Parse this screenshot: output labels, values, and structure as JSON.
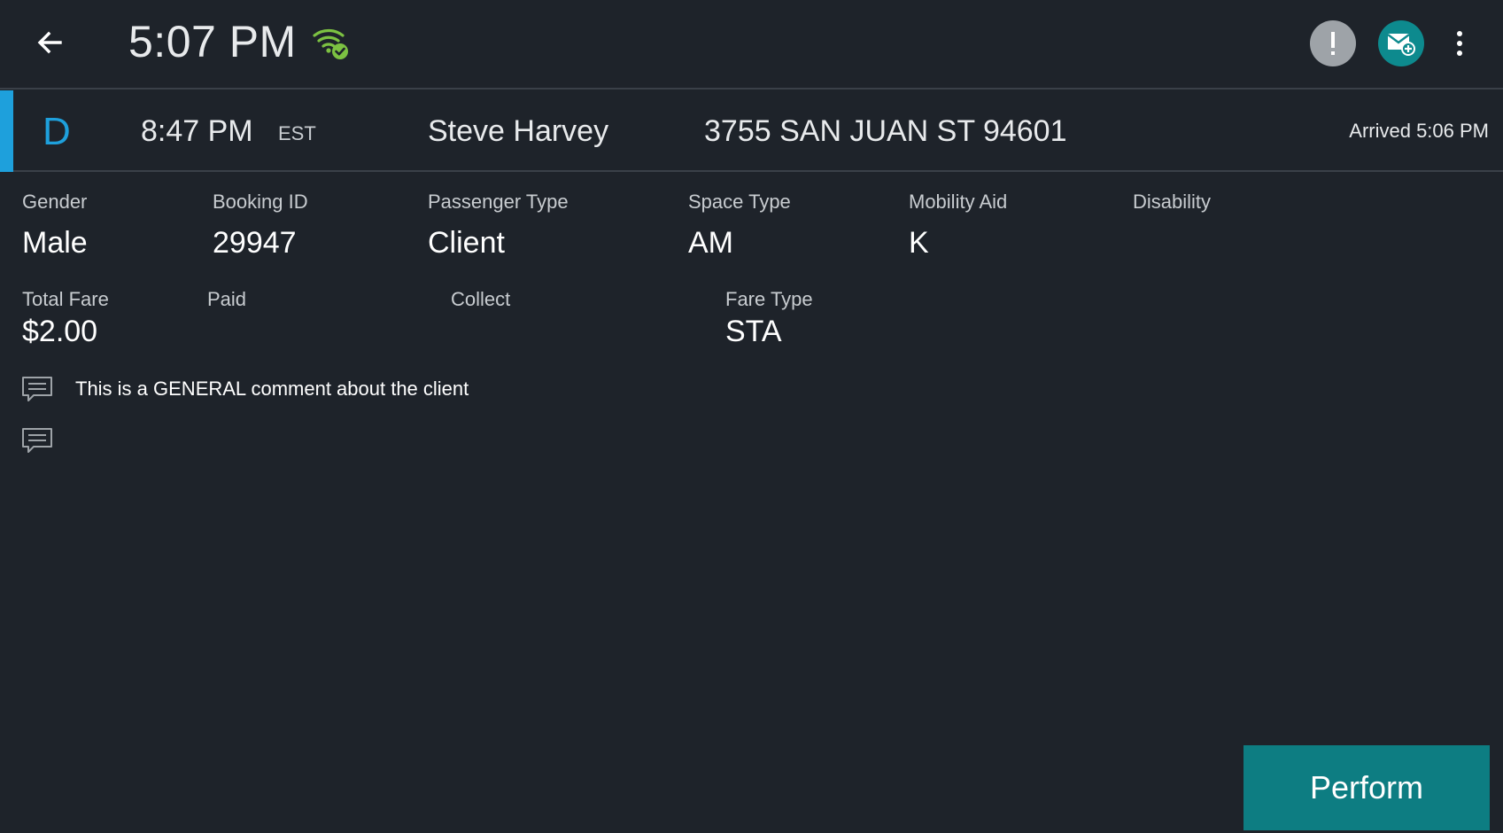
{
  "header": {
    "time": "5:07 PM",
    "icons": {
      "back": "arrow-left-icon",
      "wifi": "wifi-connected-icon",
      "alert": "exclamation-icon",
      "messages": "mail-add-icon",
      "more": "more-vertical-icon"
    },
    "colors": {
      "wifi": "#7cc142",
      "alert_bg": "#9ea3a8",
      "message_bg": "#0d8a8e"
    }
  },
  "stop": {
    "type": "D",
    "time": "8:47 PM",
    "timezone": "EST",
    "passenger_name": "Steve Harvey",
    "address": "3755 SAN JUAN ST 94601",
    "status": "Arrived 5:06 PM",
    "accent_color": "#1ea0dc"
  },
  "details": {
    "gender": {
      "label": "Gender",
      "value": "Male"
    },
    "booking_id": {
      "label": "Booking ID",
      "value": "29947"
    },
    "passenger_type": {
      "label": "Passenger Type",
      "value": "Client"
    },
    "space_type": {
      "label": "Space Type",
      "value": "AM"
    },
    "mobility_aid": {
      "label": "Mobility Aid",
      "value": "K"
    },
    "disability": {
      "label": "Disability",
      "value": ""
    }
  },
  "fare": {
    "total_fare": {
      "label": "Total Fare",
      "value": "$2.00"
    },
    "paid": {
      "label": "Paid",
      "value": ""
    },
    "collect": {
      "label": "Collect",
      "value": ""
    },
    "fare_type": {
      "label": "Fare Type",
      "value": "STA"
    }
  },
  "comments": [
    {
      "icon": "comment-icon",
      "text": "This is a GENERAL comment about the client"
    },
    {
      "icon": "comment-icon",
      "text": ""
    }
  ],
  "actions": {
    "perform_label": "Perform",
    "perform_color": "#0d7d82"
  }
}
